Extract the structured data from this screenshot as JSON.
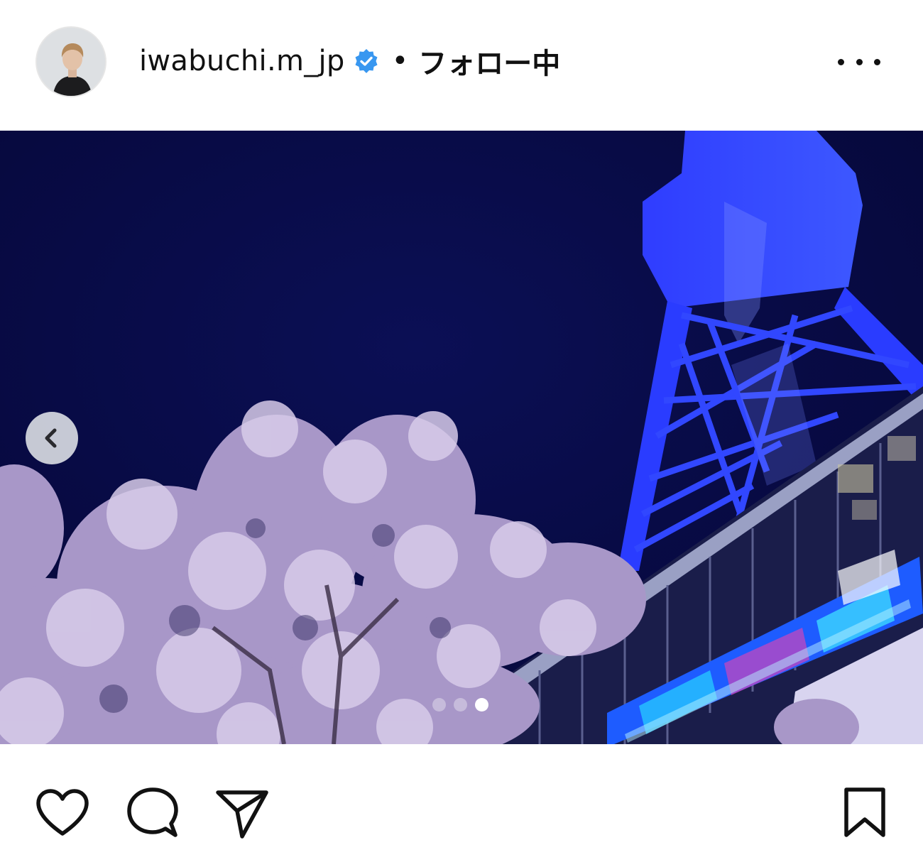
{
  "post": {
    "username": "iwabuchi.m_jp",
    "separator": "•",
    "follow_status": "フォロー中",
    "verified": true,
    "avatar_icon": "profile-avatar",
    "more_icon": "more-options-icon"
  },
  "carousel": {
    "total_slides": 3,
    "active_slide": 3,
    "prev_icon": "chevron-left-icon"
  },
  "actions": {
    "like_icon": "heart-icon",
    "comment_icon": "comment-icon",
    "share_icon": "paper-plane-icon",
    "save_icon": "bookmark-icon"
  },
  "colors": {
    "verified_badge": "#3897f0",
    "text": "#111111",
    "sky": "#07093f",
    "tower": "#2a3cff",
    "blossom": "#b7a6d6"
  }
}
